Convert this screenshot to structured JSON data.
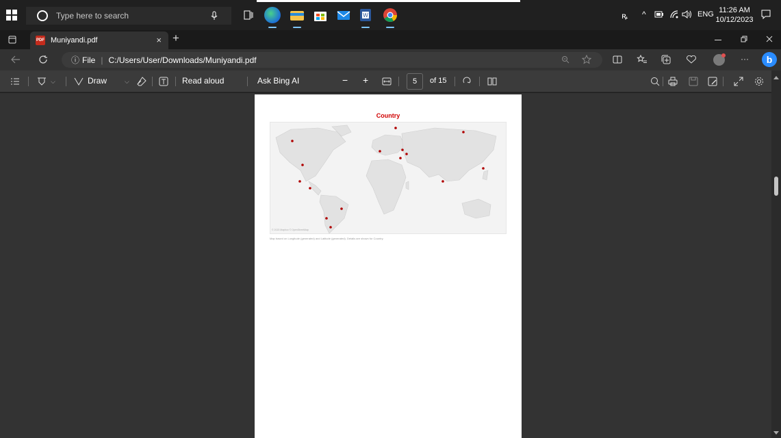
{
  "taskbar": {
    "search_placeholder": "Type here to search",
    "apps": [
      "edge-icon",
      "file-explorer-icon",
      "store-icon",
      "mail-icon",
      "word-icon",
      "chrome-icon"
    ],
    "lang": "ENG",
    "time": "11:26 AM",
    "date": "10/12/2023"
  },
  "browser": {
    "tab_title": "Muniyandi.pdf",
    "new_tab": "+",
    "close_tab": "×",
    "address": {
      "scheme": "File",
      "separator": "|",
      "path": "C:/Users/User/Downloads/Muniyandi.pdf"
    },
    "more": "···"
  },
  "pdf_toolbar": {
    "draw_label": "Draw",
    "read_aloud_label": "Read aloud",
    "ask_bing_label": "Ask Bing AI",
    "zoom_out": "−",
    "zoom_in": "+",
    "current_page": "5",
    "of_pages": "of 15"
  },
  "page": {
    "map_title": "Country",
    "attribution": "© 2023 Mapbox © OpenStreetMap",
    "caption": "Map based on Longitude (generated) and Latitude (generated). Details are shown for Country.",
    "marker_color": "#b00000"
  },
  "colors": {
    "accent": "#d00000",
    "bing": "#2a8cff"
  }
}
